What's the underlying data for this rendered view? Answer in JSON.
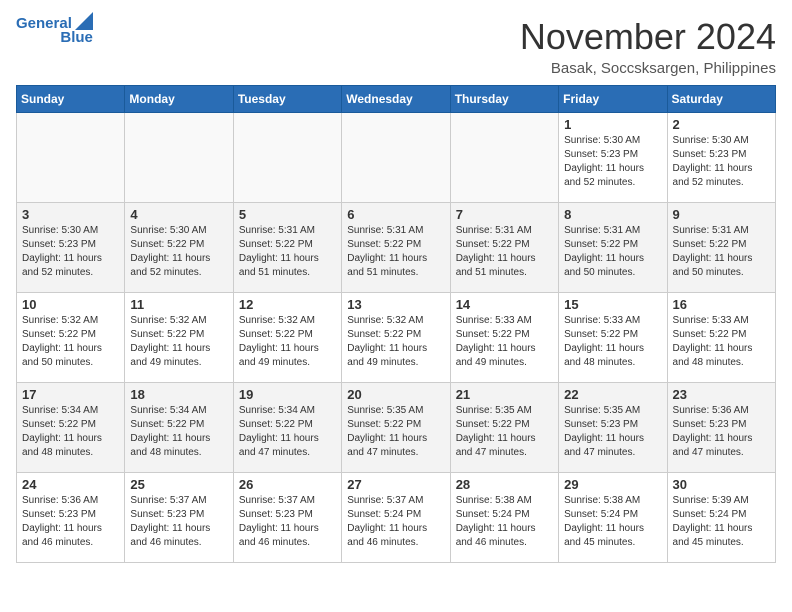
{
  "logo": {
    "line1": "General",
    "line2": "Blue"
  },
  "title": "November 2024",
  "location": "Basak, Soccsksargen, Philippines",
  "weekdays": [
    "Sunday",
    "Monday",
    "Tuesday",
    "Wednesday",
    "Thursday",
    "Friday",
    "Saturday"
  ],
  "weeks": [
    [
      {
        "day": "",
        "sunrise": "",
        "sunset": "",
        "daylight": ""
      },
      {
        "day": "",
        "sunrise": "",
        "sunset": "",
        "daylight": ""
      },
      {
        "day": "",
        "sunrise": "",
        "sunset": "",
        "daylight": ""
      },
      {
        "day": "",
        "sunrise": "",
        "sunset": "",
        "daylight": ""
      },
      {
        "day": "",
        "sunrise": "",
        "sunset": "",
        "daylight": ""
      },
      {
        "day": "1",
        "sunrise": "Sunrise: 5:30 AM",
        "sunset": "Sunset: 5:23 PM",
        "daylight": "Daylight: 11 hours and 52 minutes."
      },
      {
        "day": "2",
        "sunrise": "Sunrise: 5:30 AM",
        "sunset": "Sunset: 5:23 PM",
        "daylight": "Daylight: 11 hours and 52 minutes."
      }
    ],
    [
      {
        "day": "3",
        "sunrise": "Sunrise: 5:30 AM",
        "sunset": "Sunset: 5:23 PM",
        "daylight": "Daylight: 11 hours and 52 minutes."
      },
      {
        "day": "4",
        "sunrise": "Sunrise: 5:30 AM",
        "sunset": "Sunset: 5:22 PM",
        "daylight": "Daylight: 11 hours and 52 minutes."
      },
      {
        "day": "5",
        "sunrise": "Sunrise: 5:31 AM",
        "sunset": "Sunset: 5:22 PM",
        "daylight": "Daylight: 11 hours and 51 minutes."
      },
      {
        "day": "6",
        "sunrise": "Sunrise: 5:31 AM",
        "sunset": "Sunset: 5:22 PM",
        "daylight": "Daylight: 11 hours and 51 minutes."
      },
      {
        "day": "7",
        "sunrise": "Sunrise: 5:31 AM",
        "sunset": "Sunset: 5:22 PM",
        "daylight": "Daylight: 11 hours and 51 minutes."
      },
      {
        "day": "8",
        "sunrise": "Sunrise: 5:31 AM",
        "sunset": "Sunset: 5:22 PM",
        "daylight": "Daylight: 11 hours and 50 minutes."
      },
      {
        "day": "9",
        "sunrise": "Sunrise: 5:31 AM",
        "sunset": "Sunset: 5:22 PM",
        "daylight": "Daylight: 11 hours and 50 minutes."
      }
    ],
    [
      {
        "day": "10",
        "sunrise": "Sunrise: 5:32 AM",
        "sunset": "Sunset: 5:22 PM",
        "daylight": "Daylight: 11 hours and 50 minutes."
      },
      {
        "day": "11",
        "sunrise": "Sunrise: 5:32 AM",
        "sunset": "Sunset: 5:22 PM",
        "daylight": "Daylight: 11 hours and 49 minutes."
      },
      {
        "day": "12",
        "sunrise": "Sunrise: 5:32 AM",
        "sunset": "Sunset: 5:22 PM",
        "daylight": "Daylight: 11 hours and 49 minutes."
      },
      {
        "day": "13",
        "sunrise": "Sunrise: 5:32 AM",
        "sunset": "Sunset: 5:22 PM",
        "daylight": "Daylight: 11 hours and 49 minutes."
      },
      {
        "day": "14",
        "sunrise": "Sunrise: 5:33 AM",
        "sunset": "Sunset: 5:22 PM",
        "daylight": "Daylight: 11 hours and 49 minutes."
      },
      {
        "day": "15",
        "sunrise": "Sunrise: 5:33 AM",
        "sunset": "Sunset: 5:22 PM",
        "daylight": "Daylight: 11 hours and 48 minutes."
      },
      {
        "day": "16",
        "sunrise": "Sunrise: 5:33 AM",
        "sunset": "Sunset: 5:22 PM",
        "daylight": "Daylight: 11 hours and 48 minutes."
      }
    ],
    [
      {
        "day": "17",
        "sunrise": "Sunrise: 5:34 AM",
        "sunset": "Sunset: 5:22 PM",
        "daylight": "Daylight: 11 hours and 48 minutes."
      },
      {
        "day": "18",
        "sunrise": "Sunrise: 5:34 AM",
        "sunset": "Sunset: 5:22 PM",
        "daylight": "Daylight: 11 hours and 48 minutes."
      },
      {
        "day": "19",
        "sunrise": "Sunrise: 5:34 AM",
        "sunset": "Sunset: 5:22 PM",
        "daylight": "Daylight: 11 hours and 47 minutes."
      },
      {
        "day": "20",
        "sunrise": "Sunrise: 5:35 AM",
        "sunset": "Sunset: 5:22 PM",
        "daylight": "Daylight: 11 hours and 47 minutes."
      },
      {
        "day": "21",
        "sunrise": "Sunrise: 5:35 AM",
        "sunset": "Sunset: 5:22 PM",
        "daylight": "Daylight: 11 hours and 47 minutes."
      },
      {
        "day": "22",
        "sunrise": "Sunrise: 5:35 AM",
        "sunset": "Sunset: 5:23 PM",
        "daylight": "Daylight: 11 hours and 47 minutes."
      },
      {
        "day": "23",
        "sunrise": "Sunrise: 5:36 AM",
        "sunset": "Sunset: 5:23 PM",
        "daylight": "Daylight: 11 hours and 47 minutes."
      }
    ],
    [
      {
        "day": "24",
        "sunrise": "Sunrise: 5:36 AM",
        "sunset": "Sunset: 5:23 PM",
        "daylight": "Daylight: 11 hours and 46 minutes."
      },
      {
        "day": "25",
        "sunrise": "Sunrise: 5:37 AM",
        "sunset": "Sunset: 5:23 PM",
        "daylight": "Daylight: 11 hours and 46 minutes."
      },
      {
        "day": "26",
        "sunrise": "Sunrise: 5:37 AM",
        "sunset": "Sunset: 5:23 PM",
        "daylight": "Daylight: 11 hours and 46 minutes."
      },
      {
        "day": "27",
        "sunrise": "Sunrise: 5:37 AM",
        "sunset": "Sunset: 5:24 PM",
        "daylight": "Daylight: 11 hours and 46 minutes."
      },
      {
        "day": "28",
        "sunrise": "Sunrise: 5:38 AM",
        "sunset": "Sunset: 5:24 PM",
        "daylight": "Daylight: 11 hours and 46 minutes."
      },
      {
        "day": "29",
        "sunrise": "Sunrise: 5:38 AM",
        "sunset": "Sunset: 5:24 PM",
        "daylight": "Daylight: 11 hours and 45 minutes."
      },
      {
        "day": "30",
        "sunrise": "Sunrise: 5:39 AM",
        "sunset": "Sunset: 5:24 PM",
        "daylight": "Daylight: 11 hours and 45 minutes."
      }
    ]
  ]
}
